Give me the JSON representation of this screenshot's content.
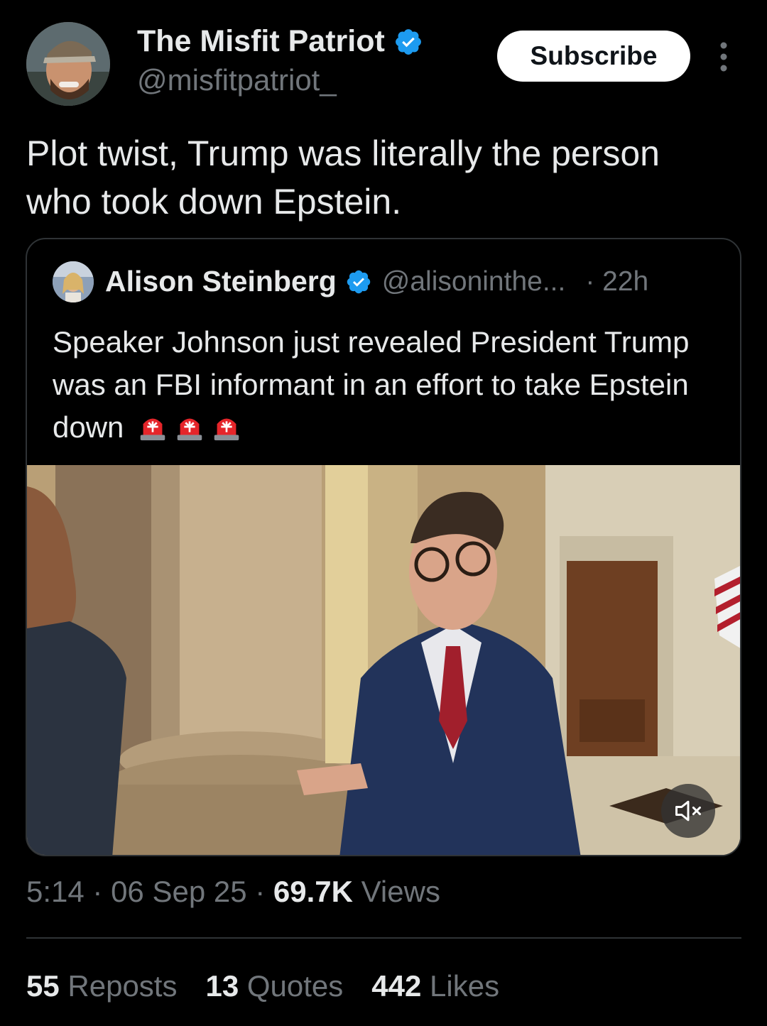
{
  "author": {
    "name": "The Misfit Patriot",
    "handle": "@misfitpatriot_"
  },
  "subscribe_label": "Subscribe",
  "tweet_text": "Plot twist, Trump was literally the person\nwho took down Epstein.",
  "quoted": {
    "name": "Alison Steinberg",
    "handle": "@alisoninthe...",
    "time": "· 22h",
    "text": "Speaker Johnson just revealed President Trump was an FBI informant in an effort to take Epstein down",
    "emoji_count": 3
  },
  "meta": {
    "time": "5:14",
    "date": "06 Sep 25",
    "views_count": "69.7K",
    "views_label": "Views"
  },
  "stats": {
    "reposts_count": "55",
    "reposts_label": "Reposts",
    "quotes_count": "13",
    "quotes_label": "Quotes",
    "likes_count": "442",
    "likes_label": "Likes"
  },
  "colors": {
    "background": "#000000",
    "text_primary": "#e7e9ea",
    "text_secondary": "#71767b",
    "verified_blue": "#1d9bf0",
    "border": "#2f3336"
  }
}
